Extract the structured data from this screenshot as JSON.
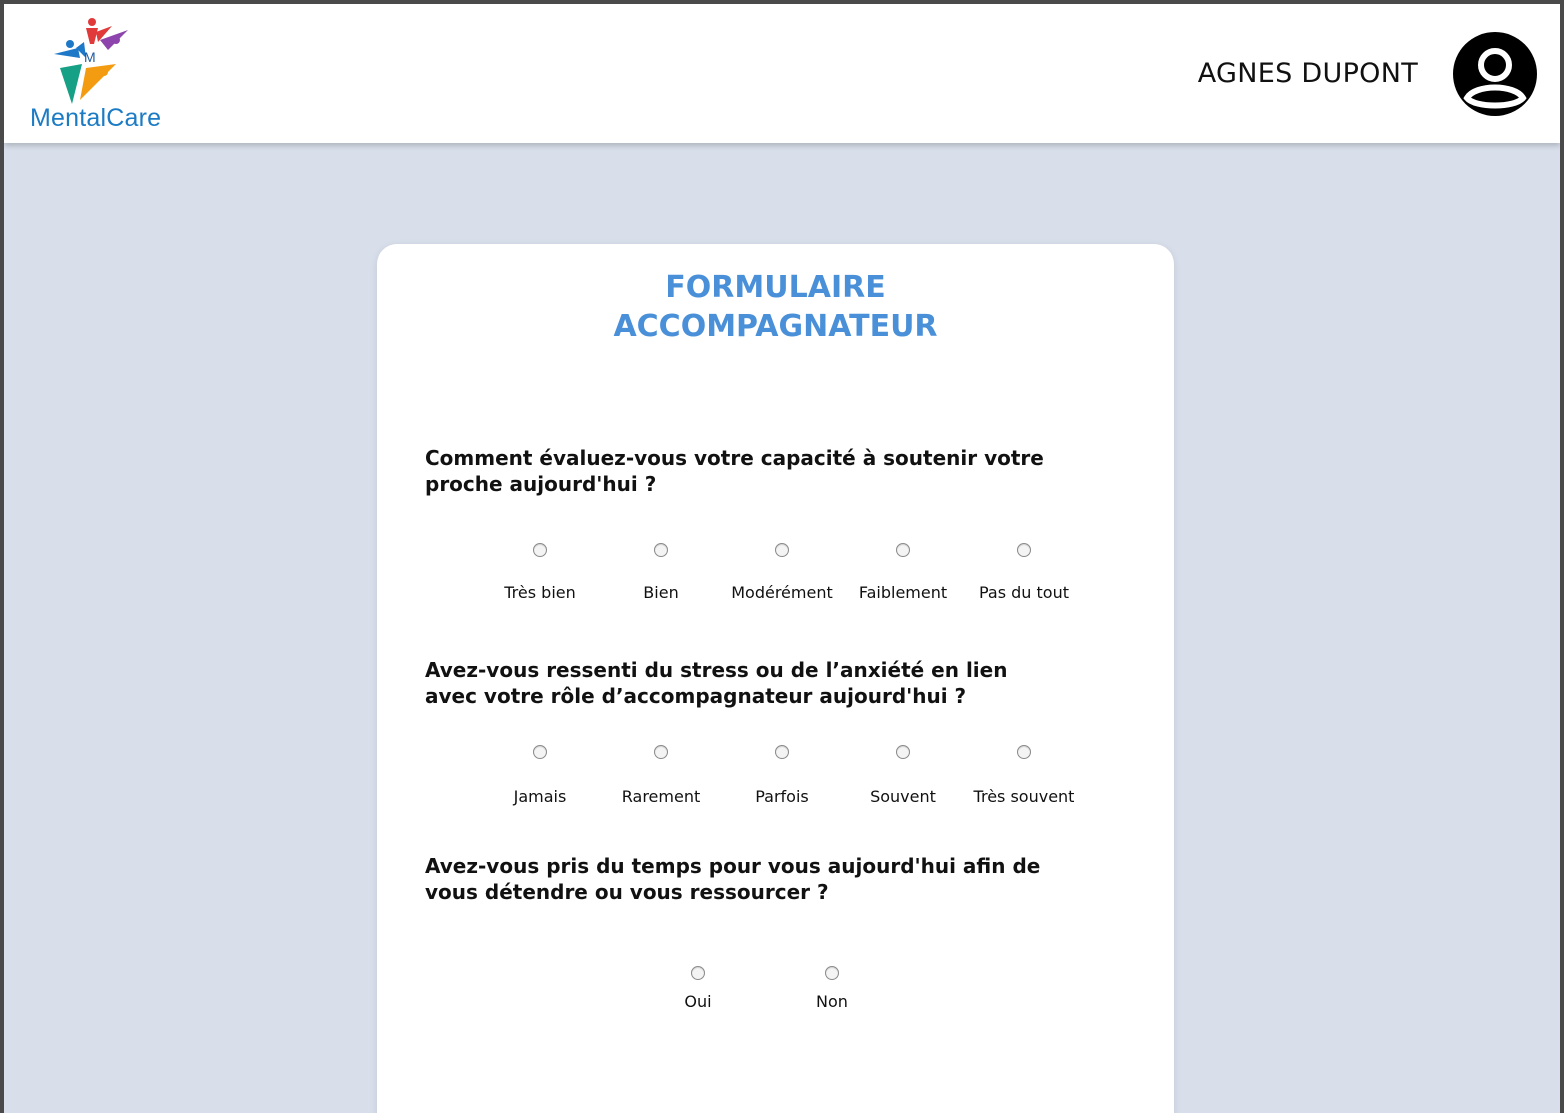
{
  "header": {
    "brand": "MentalCare",
    "logo_letter": "M",
    "user_name": "AGNES DUPONT"
  },
  "form": {
    "title_line1": "FORMULAIRE",
    "title_line2": "ACCOMPAGNATEUR",
    "questions": [
      {
        "text": "Comment évaluez-vous votre capacité à soutenir votre proche aujourd'hui ?",
        "options": [
          "Très bien",
          "Bien",
          "Modérément",
          "Faiblement",
          "Pas du tout"
        ]
      },
      {
        "text": "Avez-vous ressenti du stress ou de l’anxiété en lien avec votre rôle d’accompagnateur aujourd'hui ?",
        "options": [
          "Jamais",
          "Rarement",
          "Parfois",
          "Souvent",
          "Très souvent"
        ]
      },
      {
        "text": "Avez-vous pris du temps pour vous aujourd'hui afin de vous détendre ou vous ressourcer ?",
        "options": [
          "Oui",
          "Non"
        ]
      }
    ]
  },
  "colors": {
    "background": "#d8dfeb",
    "title": "#4a90d9",
    "brand": "#1b7bc4"
  },
  "icons": {
    "logo": "mentalcare-star-logo",
    "avatar": "user-avatar-icon"
  }
}
